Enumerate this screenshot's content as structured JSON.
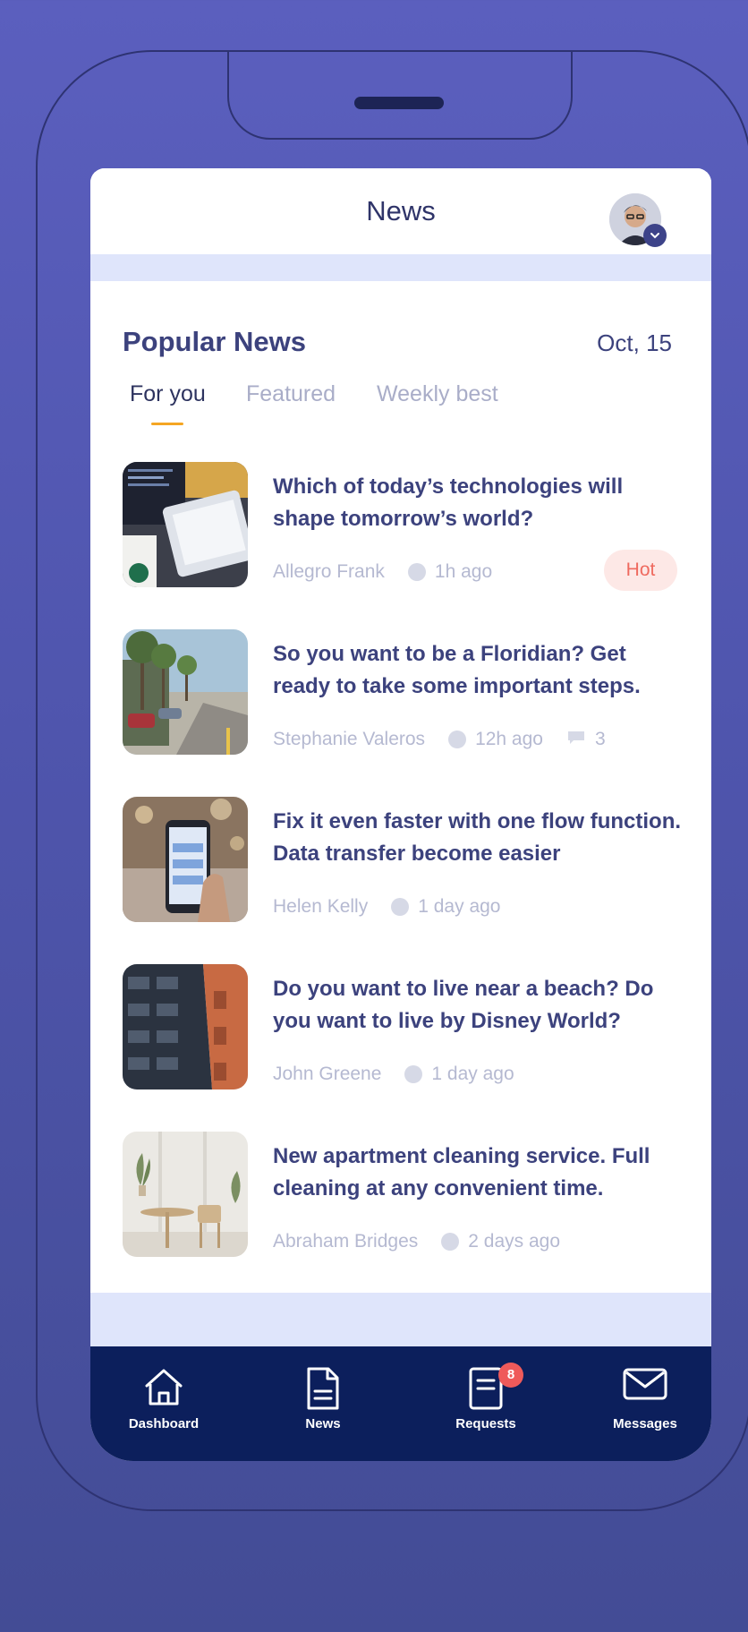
{
  "header": {
    "title": "News"
  },
  "section": {
    "title": "Popular News",
    "date": "Oct, 15"
  },
  "tabs": [
    {
      "label": "For you",
      "active": true
    },
    {
      "label": "Featured",
      "active": false
    },
    {
      "label": "Weekly best",
      "active": false
    }
  ],
  "news": [
    {
      "headline": "Which of today’s technologies will shape tomorrow’s world?",
      "author": "Allegro Frank",
      "time": "1h ago",
      "badge": "Hot",
      "thumbnail": "laptop-coffee"
    },
    {
      "headline": "So you want to be a Floridian? Get ready to take some important steps.",
      "author": "Stephanie Valeros",
      "time": "12h ago",
      "comments": "3",
      "thumbnail": "palm-street"
    },
    {
      "headline": "Fix it even faster with one flow function. Data transfer become easier",
      "author": "Helen Kelly",
      "time": "1 day ago",
      "thumbnail": "phone-in-hand"
    },
    {
      "headline": "Do you want to live near a beach? Do you want to live by Disney World?",
      "author": "John Greene",
      "time": "1 day ago",
      "thumbnail": "apartment-building"
    },
    {
      "headline": "New apartment cleaning service. Full cleaning at any convenient time.",
      "author": "Abraham Bridges",
      "time": "2 days ago",
      "thumbnail": "bright-interior"
    }
  ],
  "nav": [
    {
      "label": "Dashboard",
      "icon": "home-icon"
    },
    {
      "label": "News",
      "icon": "document-icon"
    },
    {
      "label": "Requests",
      "icon": "clipboard-icon",
      "badge": "8"
    },
    {
      "label": "Messages",
      "icon": "envelope-icon"
    }
  ],
  "colors": {
    "background": "#5b5fbe",
    "title": "#3c427d",
    "muted": "#b5b9d1",
    "accent": "#f5a623",
    "hot_bg": "#fde8e6",
    "hot_text": "#ef6a5f",
    "navbar": "#0c1f5c",
    "nav_badge": "#ef5a5a",
    "band": "#dfe5fb"
  }
}
